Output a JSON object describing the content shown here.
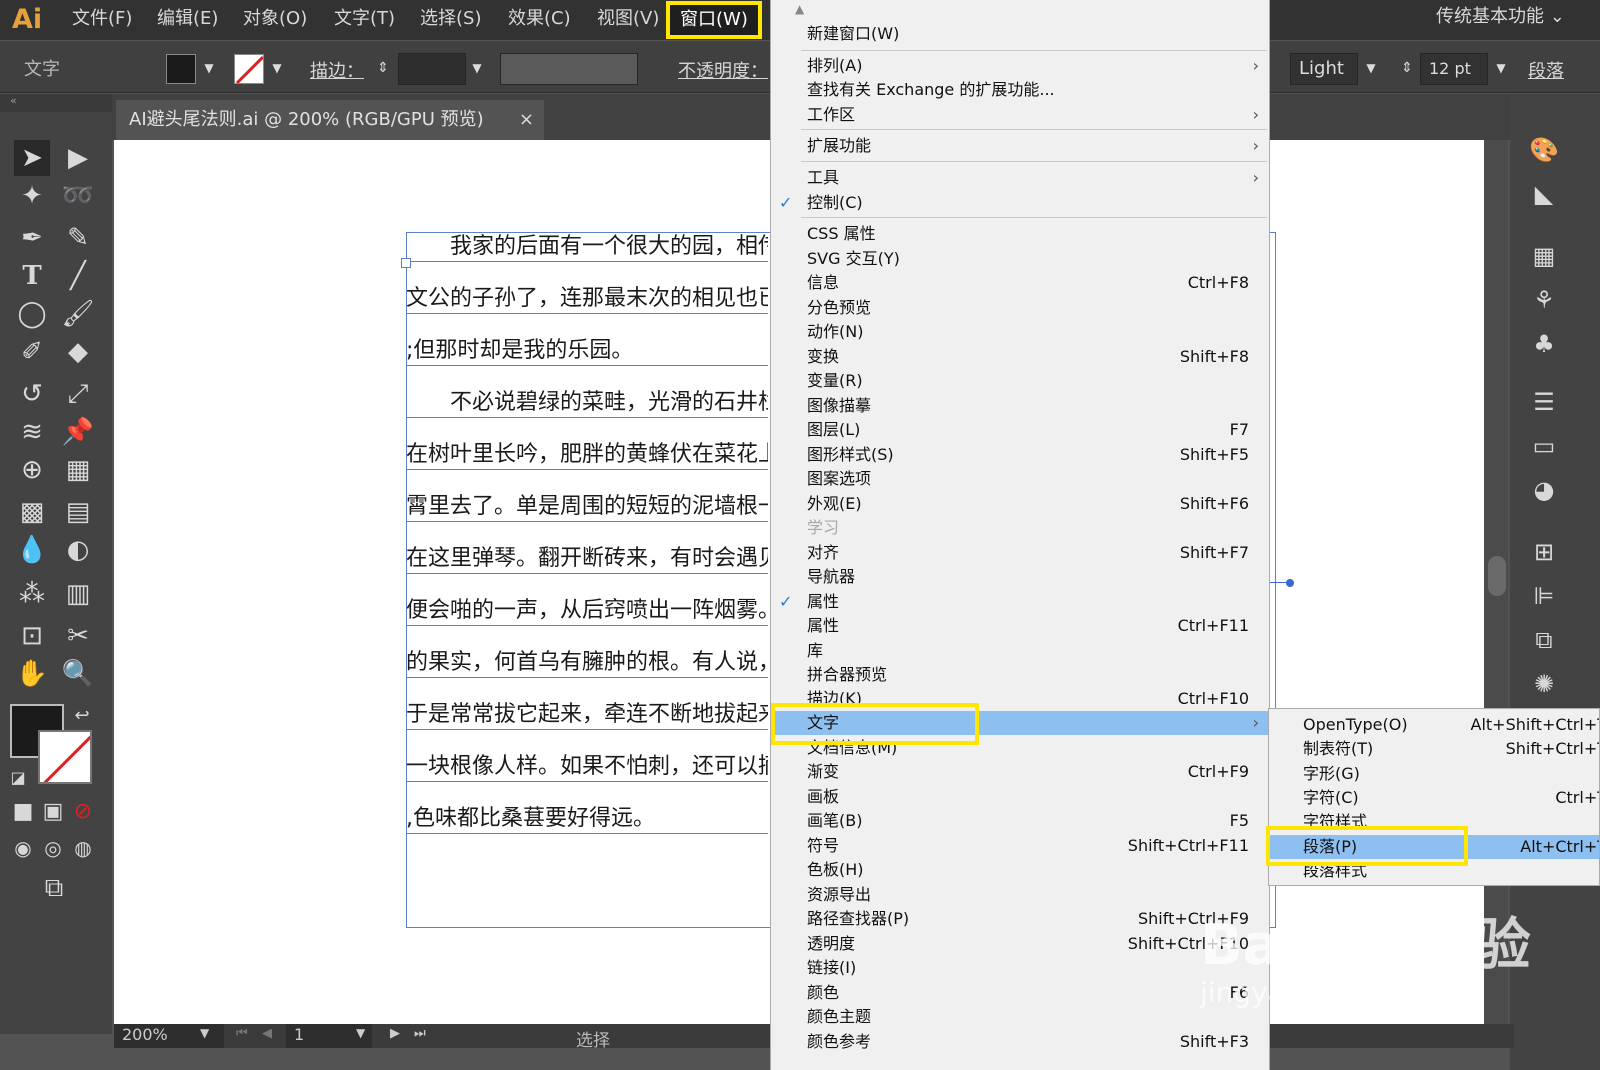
{
  "app": {
    "logo": "Ai"
  },
  "menubar": {
    "items": [
      "文件(F)",
      "编辑(E)",
      "对象(O)",
      "文字(T)",
      "选择(S)",
      "效果(C)",
      "视图(V)",
      "窗口(W)"
    ],
    "workspace": "传统基本功能 ⌄"
  },
  "control": {
    "label": "文字",
    "stroke_label": "描边：",
    "opacity_label": "不透明度：",
    "font_style": "Light",
    "font_size": "12 pt",
    "paragraph_label": "段落"
  },
  "document": {
    "tab_title": "AI避头尾法则.ai @ 200% (RGB/GPU 预览)",
    "close": "×",
    "lines": [
      "　　我家的后面有一个很大的园，相传叫作百草园。现在是早已并屋子一起卖给朱",
      "文公的子孙了，连那最末次的相见也已经隔了七八年，其中似乎确凿只有一些野草",
      ";但那时却是我的乐园。",
      "　　不必说碧绿的菜畦，光滑的石井栏，高大的皂荚树，紫红的桑葚；也不必说鸣蝉",
      "在树叶里长吟，肥胖的黄蜂伏在菜花上，轻捷的叫天子(云雀)忽然从草间直窜向云",
      "霄里去了。单是周围的短短的泥墙根一带，就有无限趣味。油蛉在这里低唱，蟋蟀们",
      "在这里弹琴。翻开断砖来，有时会遇见蜈蚣；还有斑蝥，倘若用手指按住它的脊梁，",
      "便会啪的一声，从后窍喷出一阵烟雾。何首乌藤和木莲藤缠络着，木莲有莲房一般",
      "的果实，何首乌有臃肿的根。有人说，何首乌根是有像人形的，吃了便可以成仙，我",
      "于是常常拔它起来，牵连不断地拔起来，也曾因此弄坏了泥墙，却从来没有见过有",
      "一块根像人样。如果不怕刺，还可以摘到覆盆子，像小珊瑚珠攒成的小球，又酸又甜",
      ",色味都比桑葚要好得远。"
    ]
  },
  "status": {
    "zoom": "200%",
    "page": "1",
    "tool": "选择"
  },
  "window_menu": {
    "items": [
      {
        "label": "新建窗口(W)",
        "shortcut": ""
      },
      {
        "label": "排列(A)",
        "shortcut": "",
        "submenu": true
      },
      {
        "label": "查找有关 Exchange 的扩展功能...",
        "shortcut": ""
      },
      {
        "label": "工作区",
        "shortcut": "",
        "submenu": true
      },
      {
        "label": "扩展功能",
        "shortcut": "",
        "submenu": true
      },
      {
        "label": "工具",
        "shortcut": "",
        "submenu": true
      },
      {
        "label": "控制(C)",
        "shortcut": "",
        "checked": true
      },
      {
        "label": "CSS 属性",
        "shortcut": ""
      },
      {
        "label": "SVG 交互(Y)",
        "shortcut": ""
      },
      {
        "label": "信息",
        "shortcut": "Ctrl+F8"
      },
      {
        "label": "分色预览",
        "shortcut": ""
      },
      {
        "label": "动作(N)",
        "shortcut": ""
      },
      {
        "label": "变换",
        "shortcut": "Shift+F8"
      },
      {
        "label": "变量(R)",
        "shortcut": ""
      },
      {
        "label": "图像描摹",
        "shortcut": ""
      },
      {
        "label": "图层(L)",
        "shortcut": "F7"
      },
      {
        "label": "图形样式(S)",
        "shortcut": "Shift+F5"
      },
      {
        "label": "图案选项",
        "shortcut": ""
      },
      {
        "label": "外观(E)",
        "shortcut": "Shift+F6"
      },
      {
        "label": "学习",
        "shortcut": "",
        "disabled": true
      },
      {
        "label": "对齐",
        "shortcut": "Shift+F7"
      },
      {
        "label": "导航器",
        "shortcut": ""
      },
      {
        "label": "属性",
        "shortcut": "",
        "checked": true
      },
      {
        "label": "属性",
        "shortcut": "Ctrl+F11"
      },
      {
        "label": "库",
        "shortcut": ""
      },
      {
        "label": "拼合器预览",
        "shortcut": ""
      },
      {
        "label": "描边(K)",
        "shortcut": "Ctrl+F10"
      },
      {
        "label": "文字",
        "shortcut": "",
        "submenu": true,
        "highlighted": true
      },
      {
        "label": "文档信息(M)",
        "shortcut": ""
      },
      {
        "label": "渐变",
        "shortcut": "Ctrl+F9"
      },
      {
        "label": "画板",
        "shortcut": ""
      },
      {
        "label": "画笔(B)",
        "shortcut": "F5"
      },
      {
        "label": "符号",
        "shortcut": "Shift+Ctrl+F11"
      },
      {
        "label": "色板(H)",
        "shortcut": ""
      },
      {
        "label": "资源导出",
        "shortcut": ""
      },
      {
        "label": "路径查找器(P)",
        "shortcut": "Shift+Ctrl+F9"
      },
      {
        "label": "透明度",
        "shortcut": "Shift+Ctrl+F10"
      },
      {
        "label": "链接(I)",
        "shortcut": ""
      },
      {
        "label": "颜色",
        "shortcut": "F6"
      },
      {
        "label": "颜色主题",
        "shortcut": ""
      },
      {
        "label": "颜色参考",
        "shortcut": "Shift+F3"
      }
    ]
  },
  "text_submenu": {
    "items": [
      {
        "label": "OpenType(O)",
        "shortcut": "Alt+Shift+Ctrl+T"
      },
      {
        "label": "制表符(T)",
        "shortcut": "Shift+Ctrl+T"
      },
      {
        "label": "字形(G)",
        "shortcut": ""
      },
      {
        "label": "字符(C)",
        "shortcut": "Ctrl+T"
      },
      {
        "label": "字符样式",
        "shortcut": ""
      },
      {
        "label": "段落(P)",
        "shortcut": "Alt+Ctrl+T",
        "highlighted": true
      },
      {
        "label": "段落样式",
        "shortcut": ""
      }
    ]
  },
  "watermark": {
    "brand": "Bai du 经验",
    "url": "jingyan.baidu.com"
  },
  "colors": {
    "highlight": "#8dbff0",
    "callout": "#ffe600",
    "check": "#2a7bd6"
  }
}
